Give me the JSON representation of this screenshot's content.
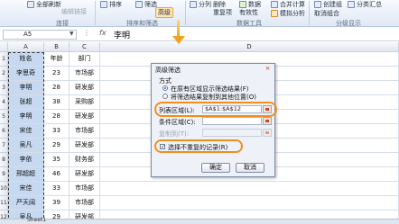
{
  "ribbon": {
    "items": [
      "全部刷新",
      "编辑链接",
      "排序",
      "筛选",
      "高级",
      "分列",
      "删除",
      "重复项",
      "数据",
      "有效性",
      "合并计算",
      "模拟分析",
      "创建组",
      "取消组合",
      "分类汇总"
    ],
    "groups": [
      "连接",
      "排序和筛选",
      "数据工具",
      "分级显示"
    ]
  },
  "formula_bar": {
    "name_box": "A5",
    "fx": "fx",
    "value": "李明"
  },
  "sheet": {
    "columns": [
      "A",
      "B",
      "C",
      "D"
    ],
    "rows": [
      {
        "row": "1",
        "cells": [
          "姓名",
          "年龄",
          "部门"
        ]
      },
      {
        "row": "2",
        "cells": [
          "李思奇",
          "23",
          "市场部"
        ]
      },
      {
        "row": "3",
        "cells": [
          "李明",
          "28",
          "研发部"
        ]
      },
      {
        "row": "4",
        "cells": [
          "张超",
          "38",
          "采购部"
        ]
      },
      {
        "row": "5",
        "cells": [
          "李明",
          "28",
          "研发部"
        ]
      },
      {
        "row": "6",
        "cells": [
          "宋佳",
          "33",
          "市场部"
        ]
      },
      {
        "row": "7",
        "cells": [
          "吴凡",
          "29",
          "研发部"
        ]
      },
      {
        "row": "8",
        "cells": [
          "李依",
          "35",
          "财务部"
        ]
      },
      {
        "row": "9",
        "cells": [
          "邢超超",
          "46",
          "研发部"
        ]
      },
      {
        "row": "10",
        "cells": [
          "宋佳",
          "33",
          "市场部"
        ]
      },
      {
        "row": "11",
        "cells": [
          "严天阔",
          "39",
          "市场部"
        ]
      },
      {
        "row": "12",
        "cells": [
          "吴凡",
          "29",
          "研发部"
        ]
      }
    ],
    "sheet_tab": "Sheet1"
  },
  "dialog": {
    "title": "高级筛选",
    "close": "×",
    "section_label": "方式",
    "option_in_place": "在原有区域显示筛选结果(F)",
    "option_copy": "将筛选结果复制到其他位置(O)",
    "list_range_label": "列表区域(L):",
    "list_range_value": "$A$1:$A$12",
    "criteria_label": "条件区域(C):",
    "copy_to_label": "复制到(T):",
    "unique_label": "选择不重复的记录(R)",
    "unique_checked": "✓",
    "ok": "确定",
    "cancel": "取消"
  },
  "colors": {
    "highlight": "#f08f1c",
    "selection": "#c6d9f1"
  }
}
